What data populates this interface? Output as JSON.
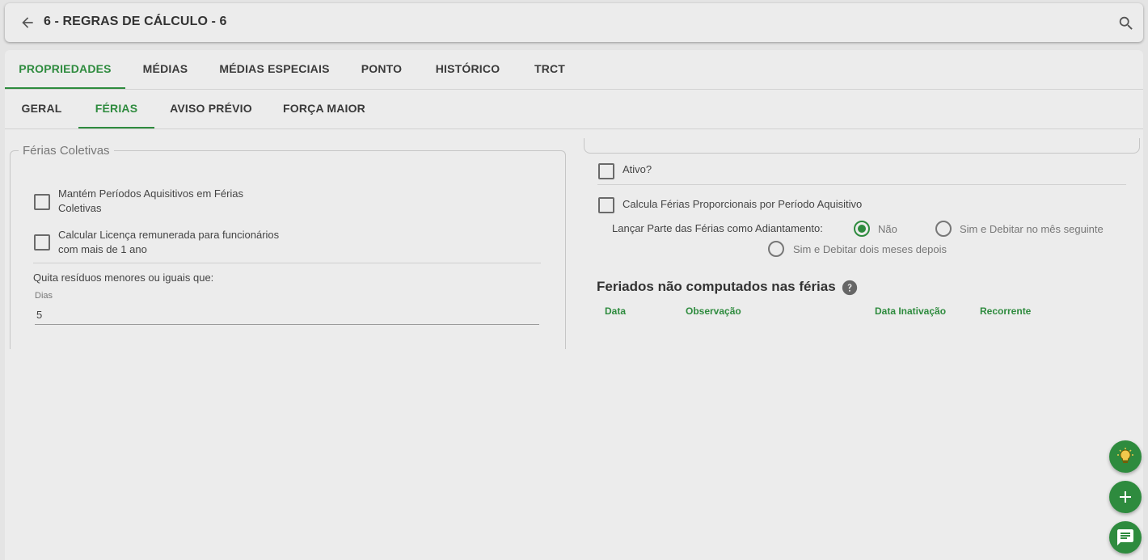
{
  "header": {
    "title": "6 - REGRAS DE CÁLCULO - 6"
  },
  "tabs": [
    {
      "label": "PROPRIEDADES",
      "active": true
    },
    {
      "label": "MÉDIAS",
      "active": false
    },
    {
      "label": "MÉDIAS ESPECIAIS",
      "active": false
    },
    {
      "label": "PONTO",
      "active": false
    },
    {
      "label": "HISTÓRICO",
      "active": false
    },
    {
      "label": "TRCT",
      "active": false
    }
  ],
  "subtabs": [
    {
      "label": "GERAL",
      "active": false
    },
    {
      "label": "FÉRIAS",
      "active": true
    },
    {
      "label": "AVISO PRÉVIO",
      "active": false
    },
    {
      "label": "FORÇA MAIOR",
      "active": false
    }
  ],
  "ferias_coletivas": {
    "legend": "Férias Coletivas",
    "mantem_label_1": "Mantém Períodos Aquisitivos em Férias",
    "mantem_label_2": "Coletivas",
    "mantem_checked": false,
    "licenca_label_1": "Calcular Licença remunerada para funcionários",
    "licenca_label_2": "com mais de 1 ano",
    "licenca_checked": false,
    "quita_label": "Quita resíduos menores ou iguais que:",
    "dias_caption": "Dias",
    "dias_value": "5"
  },
  "right": {
    "ativo_label": "Ativo?",
    "ativo_checked": false,
    "proporcionais_label": "Calcula Férias Proporcionais por Período Aquisitivo",
    "proporcionais_checked": false,
    "adiantamento_label": "Lançar Parte das Férias como Adiantamento:",
    "radio_options": [
      {
        "label": "Não",
        "checked": true
      },
      {
        "label": "Sim e Debitar no mês seguinte",
        "checked": false
      },
      {
        "label": "Sim e Debitar dois meses depois",
        "checked": false
      }
    ],
    "feriados_title": "Feriados não computados nas férias",
    "columns": [
      "Data",
      "Observação",
      "Data Inativação",
      "Recorrente"
    ]
  },
  "colors": {
    "accent": "#2e8b3e",
    "background": "#e4e4e4",
    "card": "#ececec"
  },
  "fabs": [
    "lightbulb-icon",
    "plus-icon",
    "chat-icon"
  ]
}
